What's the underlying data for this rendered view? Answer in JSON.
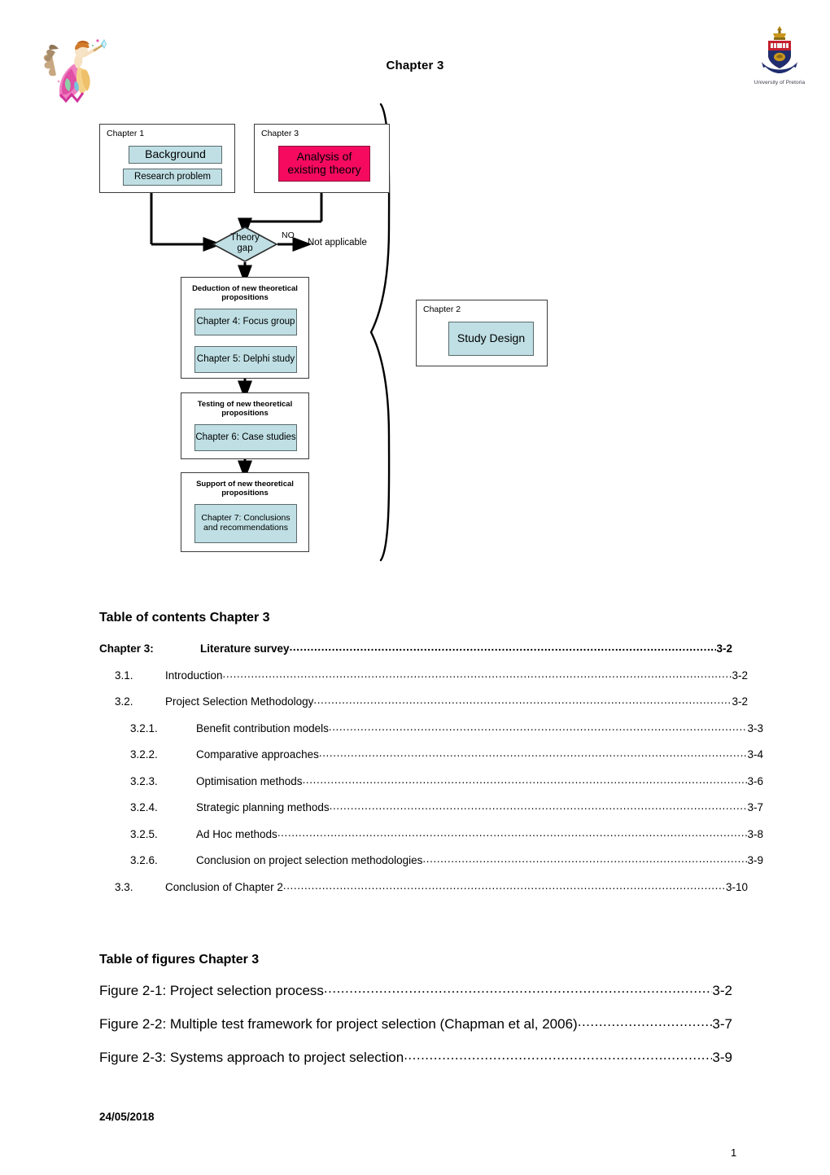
{
  "header": {
    "title": "Chapter 3",
    "university_logo_caption": "University of Pretoria",
    "left_logo_name": "decorative-fairy-clipart"
  },
  "flowchart": {
    "boxes": {
      "chapter1": {
        "label": "Chapter 1",
        "items": [
          "Background",
          "Research problem"
        ]
      },
      "chapter3": {
        "label": "Chapter 3",
        "items": [
          "Analysis of existing theory"
        ],
        "highlight_color": "#f50a5f"
      },
      "chapter2": {
        "label": "Chapter 2",
        "items": [
          "Study Design"
        ]
      },
      "deduction": {
        "title": "Deduction of new theoretical propositions",
        "items": [
          "Chapter 4: Focus group",
          "Chapter 5: Delphi study"
        ]
      },
      "testing": {
        "title": "Testing of new theoretical propositions",
        "items": [
          "Chapter 6: Case studies"
        ]
      },
      "support": {
        "title": "Support of new theoretical propositions",
        "items": [
          "Chapter 7: Conclusions and recommendations"
        ]
      }
    },
    "decision": {
      "label_line1": "Theory",
      "label_line2": "gap",
      "branch_label": "NO",
      "branch_target": "Not applicable"
    },
    "colors": {
      "chip_fill": "#bfdfe4",
      "chip_border": "#5a6a6c",
      "highlight_fill": "#f50a5f",
      "box_border": "#3b3b3b"
    }
  },
  "contents": {
    "heading": "Table of contents Chapter 3",
    "entries": [
      {
        "level": 1,
        "number": "Chapter 3:",
        "title": "Literature survey",
        "page": "3-2"
      },
      {
        "level": 2,
        "number": "3.1.",
        "title": "Introduction",
        "page": "3-2"
      },
      {
        "level": 2,
        "number": "3.2.",
        "title": "Project Selection Methodology",
        "page": "3-2"
      },
      {
        "level": 3,
        "number": "3.2.1.",
        "title": "Benefit contribution models",
        "page": "3-3"
      },
      {
        "level": 3,
        "number": "3.2.2.",
        "title": "Comparative approaches",
        "page": "3-4"
      },
      {
        "level": 3,
        "number": "3.2.3.",
        "title": "Optimisation methods",
        "page": "3-6"
      },
      {
        "level": 3,
        "number": "3.2.4.",
        "title": "Strategic planning methods",
        "page": "3-7"
      },
      {
        "level": 3,
        "number": "3.2.5.",
        "title": "Ad Hoc methods",
        "page": "3-8"
      },
      {
        "level": 3,
        "number": "3.2.6.",
        "title": "Conclusion on project selection methodologies",
        "page": "3-9"
      },
      {
        "level": 2,
        "number": "3.3.",
        "title": "Conclusion of Chapter 2",
        "page": "3-10"
      }
    ]
  },
  "figures": {
    "heading": "Table of figures Chapter 3",
    "entries": [
      {
        "title": "Figure 2-1: Project selection process",
        "page": "3-2"
      },
      {
        "title": "Figure 2-2: Multiple test framework for project selection (Chapman et al, 2006)",
        "page": "3-7"
      },
      {
        "title": "Figure 2-3: Systems approach to project selection",
        "page": "3-9"
      }
    ]
  },
  "footer": {
    "date": "24/05/2018",
    "page_number": "1"
  }
}
